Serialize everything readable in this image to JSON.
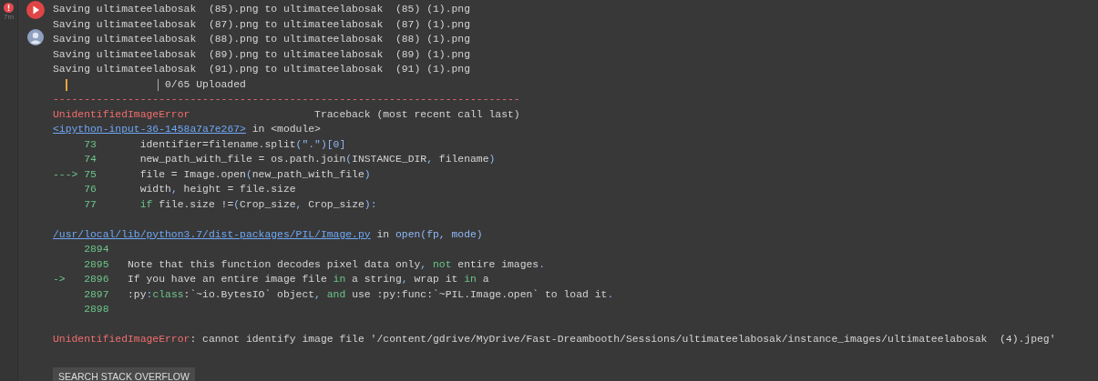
{
  "cell": {
    "error": true,
    "elapsed": "7m"
  },
  "output": [
    {
      "kind": "text",
      "parts": [
        {
          "text": "Saving ultimateelabosak  (85).png to ultimateelabosak  (85) (1).png",
          "kind": "plain"
        }
      ]
    },
    {
      "kind": "text",
      "parts": [
        {
          "text": "Saving ultimateelabosak  (87).png to ultimateelabosak  (87) (1).png",
          "kind": "plain"
        }
      ]
    },
    {
      "kind": "text",
      "parts": [
        {
          "text": "Saving ultimateelabosak  (88).png to ultimateelabosak  (88) (1).png",
          "kind": "plain"
        }
      ]
    },
    {
      "kind": "text",
      "parts": [
        {
          "text": "Saving ultimateelabosak  (89).png to ultimateelabosak  (89) (1).png",
          "kind": "plain"
        }
      ]
    },
    {
      "kind": "text",
      "parts": [
        {
          "text": "Saving ultimateelabosak  (91).png to ultimateelabosak  (91) (1).png",
          "kind": "plain"
        }
      ]
    },
    {
      "kind": "progress",
      "level": 0,
      "label": "0/65 Uploaded"
    },
    {
      "kind": "text",
      "parts": [
        {
          "text": "---------------------------------------------------------------------------",
          "kind": "error"
        }
      ]
    },
    {
      "kind": "header",
      "parts": [
        {
          "text": "UnidentifiedImageError",
          "kind": "error"
        },
        {
          "text": "Traceback (most recent call last)",
          "kind": "plain"
        }
      ]
    },
    {
      "kind": "frame",
      "link": "<ipython-input-36-1458a7a7e267>",
      "context": [
        {
          "text": " in <module>",
          "kind": "plain"
        }
      ]
    },
    {
      "kind": "code",
      "number": "73",
      "code": [
        {
          "text": "identifier=filename.split",
          "kind": "plain"
        },
        {
          "text": "(\".\")[0]",
          "kind": "punct"
        }
      ]
    },
    {
      "kind": "code",
      "number": "74",
      "code": [
        {
          "text": "new_path_with_file = os.path.join",
          "kind": "plain"
        },
        {
          "text": "(",
          "kind": "punct"
        },
        {
          "text": "INSTANCE_DIR",
          "kind": "plain"
        },
        {
          "text": ",",
          "kind": "punct"
        },
        {
          "text": " filename",
          "kind": "plain"
        },
        {
          "text": ")",
          "kind": "punct"
        }
      ]
    },
    {
      "kind": "code",
      "marker": "--->",
      "number": "75",
      "code": [
        {
          "text": "file = Image.open",
          "kind": "plain"
        },
        {
          "text": "(",
          "kind": "punct"
        },
        {
          "text": "new_path_with_file",
          "kind": "plain"
        },
        {
          "text": ")",
          "kind": "punct"
        }
      ]
    },
    {
      "kind": "code",
      "number": "76",
      "code": [
        {
          "text": "width",
          "kind": "plain"
        },
        {
          "text": ",",
          "kind": "punct"
        },
        {
          "text": " height = file.size",
          "kind": "plain"
        }
      ]
    },
    {
      "kind": "code",
      "number": "77",
      "code": [
        {
          "text": "if",
          "kind": "keyword"
        },
        {
          "text": " file.size !=",
          "kind": "plain"
        },
        {
          "text": "(",
          "kind": "punct"
        },
        {
          "text": "Crop_size",
          "kind": "plain"
        },
        {
          "text": ",",
          "kind": "punct"
        },
        {
          "text": " Crop_size",
          "kind": "plain"
        },
        {
          "text": "):",
          "kind": "punct"
        }
      ]
    },
    {
      "kind": "blank"
    },
    {
      "kind": "frame",
      "link": "/usr/local/lib/python3.7/dist-packages/PIL/Image.py",
      "context": [
        {
          "text": " in ",
          "kind": "plain"
        },
        {
          "text": "open(fp, mode)",
          "kind": "punct"
        }
      ]
    },
    {
      "kind": "code",
      "number": "2894"
    },
    {
      "kind": "code",
      "number": "2895",
      "code": [
        {
          "text": "Note that this function decodes pixel data only",
          "kind": "plain"
        },
        {
          "text": ", ",
          "kind": "punct"
        },
        {
          "text": "not",
          "kind": "keyword"
        },
        {
          "text": " entire images",
          "kind": "plain"
        },
        {
          "text": ".",
          "kind": "punct"
        }
      ]
    },
    {
      "kind": "code",
      "marker": "->",
      "number": "2896",
      "code": [
        {
          "text": "If you have an entire image file ",
          "kind": "plain"
        },
        {
          "text": "in",
          "kind": "keyword"
        },
        {
          "text": " a string",
          "kind": "plain"
        },
        {
          "text": ",",
          "kind": "punct"
        },
        {
          "text": " wrap it ",
          "kind": "plain"
        },
        {
          "text": "in",
          "kind": "keyword"
        },
        {
          "text": " a",
          "kind": "plain"
        }
      ]
    },
    {
      "kind": "code",
      "number": "2897",
      "code": [
        {
          "text": ":py",
          "kind": "plain"
        },
        {
          "text": ":",
          "kind": "punct"
        },
        {
          "text": "class",
          "kind": "keyword"
        },
        {
          "text": ":`~io.BytesIO` object",
          "kind": "plain"
        },
        {
          "text": ", ",
          "kind": "punct"
        },
        {
          "text": "and",
          "kind": "keyword"
        },
        {
          "text": " use :py:func:`~PIL.Image.open` to load it",
          "kind": "plain"
        },
        {
          "text": ".",
          "kind": "punct"
        }
      ]
    },
    {
      "kind": "code",
      "number": "2898"
    },
    {
      "kind": "blank"
    },
    {
      "kind": "error",
      "parts": [
        {
          "text": "UnidentifiedImageError",
          "kind": "error"
        },
        {
          "text": ": cannot identify image file '/content/gdrive/MyDrive/Fast-Dreambooth/Sessions/ultimateelabosak/instance_images/ultimateelabosak  (4).jpeg'",
          "kind": "plain"
        }
      ]
    }
  ],
  "search_button": "SEARCH STACK OVERFLOW"
}
